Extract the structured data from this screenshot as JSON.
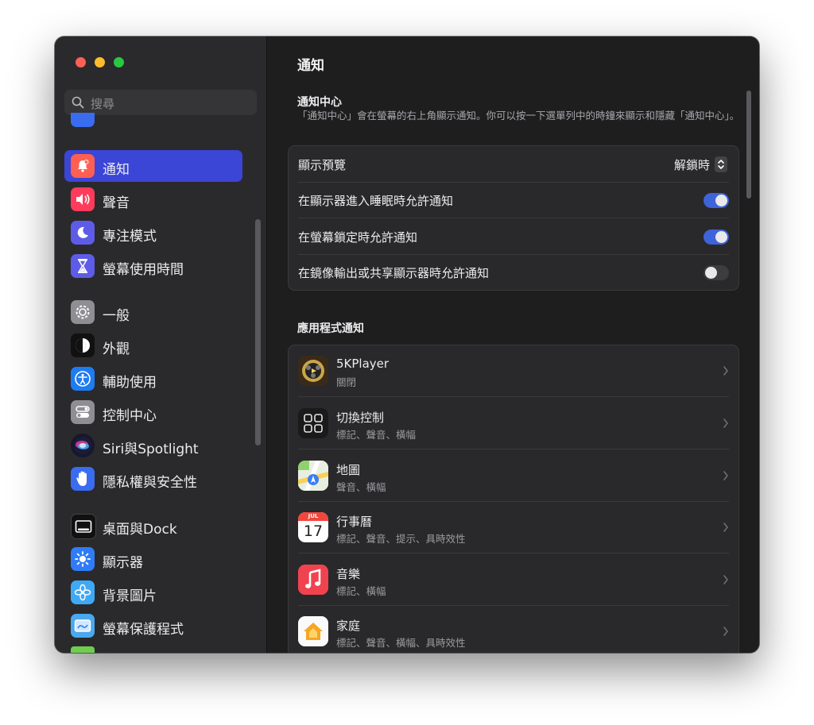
{
  "window": {
    "title": "通知"
  },
  "sidebar": {
    "search_placeholder": "搜尋",
    "items": [
      {
        "label": "通知",
        "icon": "bell-icon",
        "color": "#ff5f52",
        "active": true
      },
      {
        "label": "聲音",
        "icon": "speaker-icon",
        "color": "#ff3b5c"
      },
      {
        "label": "專注模式",
        "icon": "moon-icon",
        "color": "#5e5ce6"
      },
      {
        "label": "螢幕使用時間",
        "icon": "hourglass-icon",
        "color": "#5e5ce6"
      },
      {
        "label": "一般",
        "icon": "gear-icon",
        "color": "#8e8e93"
      },
      {
        "label": "外觀",
        "icon": "appearance-icon",
        "color": "#111111"
      },
      {
        "label": "輔助使用",
        "icon": "accessibility-icon",
        "color": "#1e7cf2"
      },
      {
        "label": "控制中心",
        "icon": "control-center-icon",
        "color": "#8e8e93"
      },
      {
        "label": "Siri與Spotlight",
        "icon": "siri-icon",
        "color": "#2b2b60"
      },
      {
        "label": "隱私權與安全性",
        "icon": "hand-icon",
        "color": "#3a6cf0"
      },
      {
        "label": "桌面與Dock",
        "icon": "dock-icon",
        "color": "#111111"
      },
      {
        "label": "顯示器",
        "icon": "display-icon",
        "color": "#2f7cf6"
      },
      {
        "label": "背景圖片",
        "icon": "wallpaper-icon",
        "color": "#3fa9f5"
      },
      {
        "label": "螢幕保護程式",
        "icon": "screensaver-icon",
        "color": "#4aa8f0"
      }
    ]
  },
  "main": {
    "title": "通知",
    "nc_section": {
      "title": "通知中心",
      "description": "「通知中心」會在螢幕的右上角顯示通知。你可以按一下選單列中的時鐘來顯示和隱藏「通知中心」。"
    },
    "settings": [
      {
        "label": "顯示預覽",
        "value": "解鎖時"
      },
      {
        "label": "在顯示器進入睡眠時允許通知",
        "toggle": true
      },
      {
        "label": "在螢幕鎖定時允許通知",
        "toggle": true
      },
      {
        "label": "在鏡像輸出或共享顯示器時允許通知",
        "toggle": false
      }
    ],
    "apps_section": {
      "title": "應用程式通知"
    },
    "apps": [
      {
        "name": "5KPlayer",
        "sub": "關閉",
        "icon": "5kplayer-icon"
      },
      {
        "name": "切換控制",
        "sub": "標記、聲音、橫幅",
        "icon": "switch-control-icon"
      },
      {
        "name": "地圖",
        "sub": "聲音、橫幅",
        "icon": "maps-icon"
      },
      {
        "name": "行事曆",
        "sub": "標記、聲音、提示、具時效性",
        "icon": "calendar-icon",
        "cal_month": "JUL",
        "cal_day": "17"
      },
      {
        "name": "音樂",
        "sub": "標記、橫幅",
        "icon": "music-icon"
      },
      {
        "name": "家庭",
        "sub": "標記、聲音、橫幅、具時效性",
        "icon": "home-icon"
      }
    ]
  }
}
